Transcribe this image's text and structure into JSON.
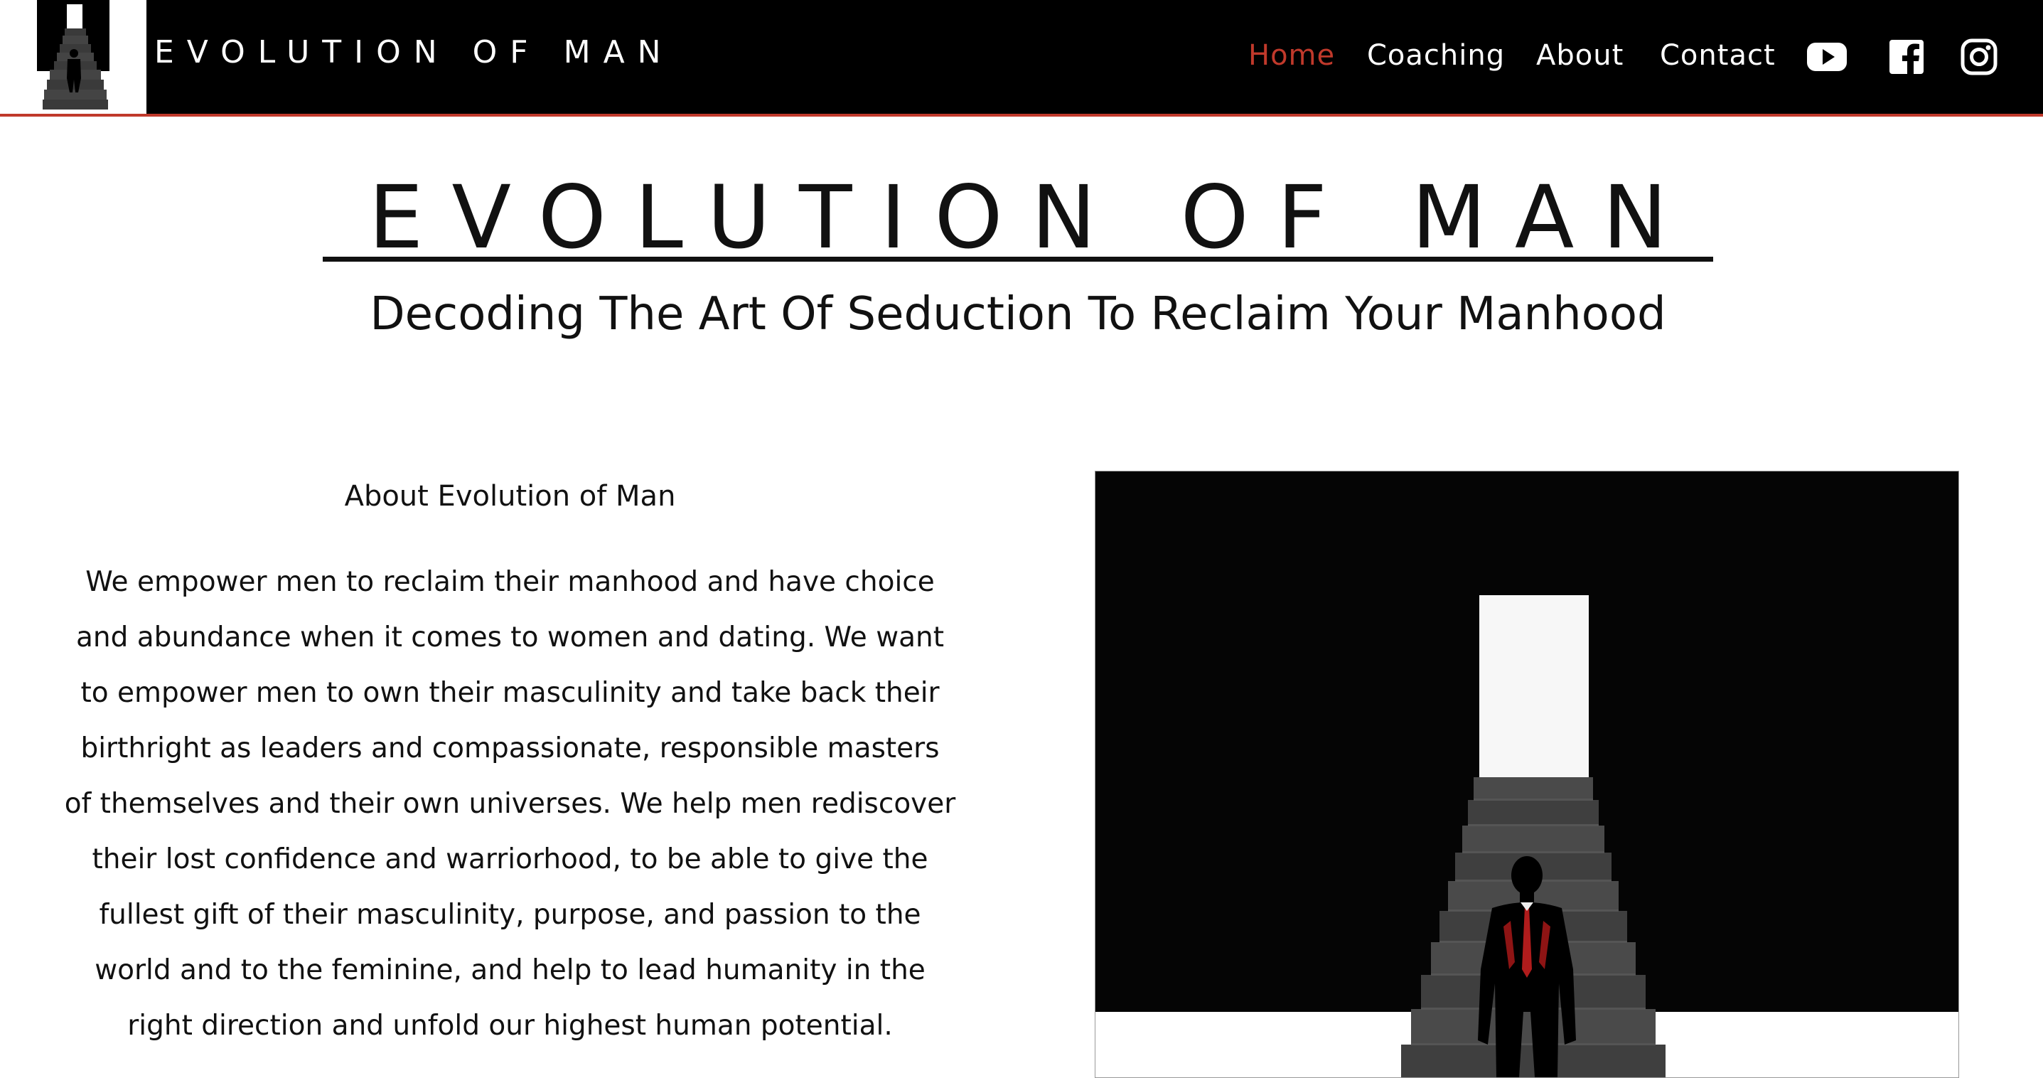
{
  "header": {
    "brand": "EVOLUTION OF MAN",
    "nav": [
      {
        "label": "Home",
        "active": true
      },
      {
        "label": "Coaching",
        "active": false
      },
      {
        "label": "About",
        "active": false
      },
      {
        "label": "Contact",
        "active": false
      }
    ],
    "social_icons": [
      "youtube-icon",
      "facebook-icon",
      "instagram-icon"
    ]
  },
  "hero": {
    "title": "EVOLUTION OF MAN",
    "subtitle": "Decoding The Art Of Seduction To Reclaim Your Manhood"
  },
  "about": {
    "heading": "About Evolution of Man",
    "body": "We empower men to reclaim their manhood and have choice and abundance when it comes to women and dating. We want to empower men to own their masculinity and take back their birthright as leaders and compassionate, responsible masters of themselves and their own universes. We help men rediscover their lost confidence and warriorhood, to be able to give the fullest gift of their masculinity, purpose, and passion to the world and to the feminine, and help to lead humanity in the right direction and unfold our highest human potential."
  },
  "colors": {
    "header_bg": "#000000",
    "accent": "#c0392b",
    "text": "#111111",
    "page_bg": "#ffffff"
  }
}
